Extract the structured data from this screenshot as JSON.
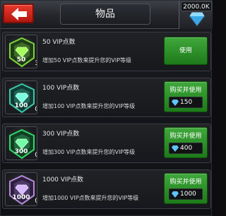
{
  "header": {
    "title": "物品",
    "currency_amount": "2000.0K"
  },
  "items": [
    {
      "name": "50 VIP点数",
      "desc": "增加50 VIP点数来提升您的VIP等级",
      "badge": "50",
      "qty": "3",
      "action": "use",
      "action_label": "使用",
      "badge_color": "#7fd33a"
    },
    {
      "name": "100 VIP点数",
      "desc": "增加100 VIP点数来提升您的VIP等级",
      "badge": "100",
      "qty": "0",
      "action": "buy",
      "action_label": "购买并使用",
      "price": "150",
      "badge_color": "#3cc8a8"
    },
    {
      "name": "300 VIP点数",
      "desc": "增加300 VIP点数来提升您的VIP等级",
      "badge": "300",
      "qty": "0",
      "action": "buy",
      "action_label": "购买并使用",
      "price": "400",
      "badge_color": "#2fd86a"
    },
    {
      "name": "1000 VIP点数",
      "desc": "增加1000 VIP点数来提升您的VIP等级",
      "badge": "1000",
      "qty": "0",
      "action": "buy",
      "action_label": "购买并使用",
      "price": "1000",
      "badge_color": "#b48ad8"
    }
  ],
  "icons": {
    "back": "back-arrow-icon",
    "currency": "diamond-icon",
    "price": "diamond-icon",
    "item": "vip-badge-icon"
  },
  "colors": {
    "back_button": "#d42a1e",
    "action_button": "#2f8f2a",
    "diamond": "#5fc3ff"
  }
}
